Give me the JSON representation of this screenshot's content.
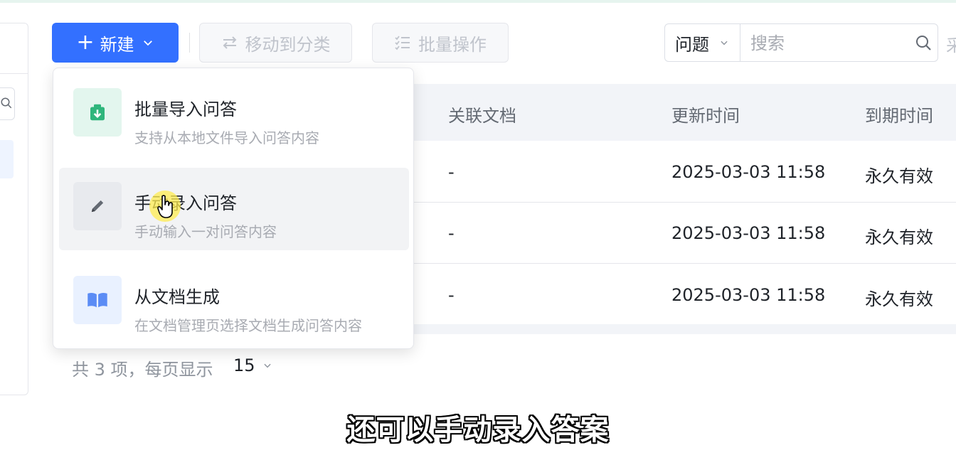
{
  "toolbar": {
    "new_label": "新建",
    "move_label": "移动到分类",
    "batch_label": "批量操作"
  },
  "search": {
    "type_value": "问题",
    "placeholder": "搜索",
    "edge_text": "采"
  },
  "dropdown": {
    "items": [
      {
        "title": "批量导入问答",
        "desc": "支持从本地文件导入问答内容",
        "icon": "import-download-icon"
      },
      {
        "title": "手动录入问答",
        "desc": "手动输入一对问答内容",
        "icon": "pencil-icon"
      },
      {
        "title": "从文档生成",
        "desc": "在文档管理页选择文档生成问答内容",
        "icon": "book-icon"
      }
    ]
  },
  "table": {
    "columns": [
      "关联文档",
      "更新时间",
      "到期时间"
    ],
    "rows": [
      {
        "doc": "-",
        "updated": "2025-03-03 11:58",
        "expiry": "永久有效"
      },
      {
        "doc": "-",
        "updated": "2025-03-03 11:58",
        "expiry": "永久有效"
      },
      {
        "doc": "-",
        "updated": "2025-03-03 11:58",
        "expiry": "永久有效"
      }
    ]
  },
  "pagination": {
    "total_text": "共 3 项，每页显示",
    "page_size": "15"
  },
  "subtitle": "还可以手动录入答案",
  "colors": {
    "primary": "#3370ff",
    "import_icon_bg": "#e3f6ee",
    "import_icon_fg": "#2fb67c",
    "book_icon_bg": "#e9f1ff",
    "book_icon_fg": "#5b8cf5"
  }
}
